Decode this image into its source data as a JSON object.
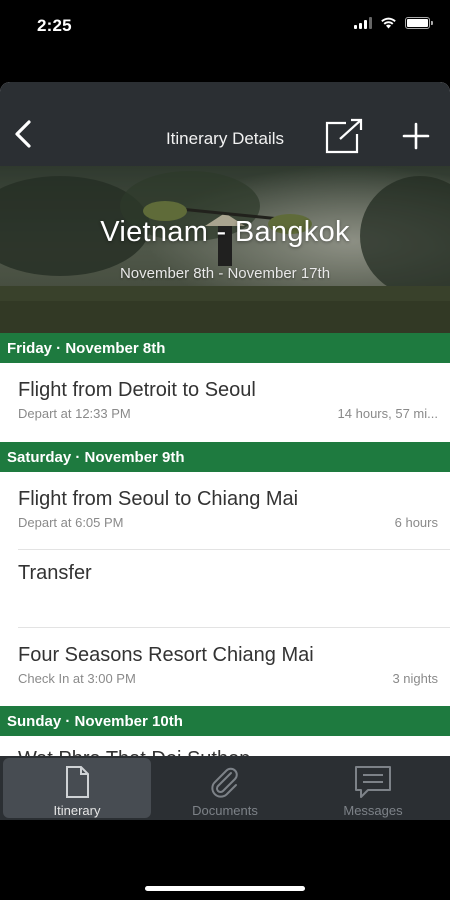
{
  "status_bar": {
    "time": "2:25"
  },
  "nav": {
    "title": "Itinerary Details",
    "back_icon": "chevron-left-icon",
    "share_icon": "share-external-icon",
    "add_icon": "plus-icon"
  },
  "hero": {
    "title": "Vietnam - Bangkok",
    "dates": "November 8th - November 17th"
  },
  "days": [
    {
      "header": "Friday · November 8th",
      "items": [
        {
          "title": "Flight from Detroit to Seoul",
          "subtitle": "Depart at 12:33 PM",
          "meta": "14 hours, 57 mi..."
        }
      ]
    },
    {
      "header": "Saturday · November 9th",
      "items": [
        {
          "title": "Flight from Seoul to Chiang Mai",
          "subtitle": "Depart at 6:05 PM",
          "meta": "6 hours"
        },
        {
          "title": "Transfer",
          "subtitle": "",
          "meta": ""
        },
        {
          "title": "Four Seasons Resort Chiang Mai",
          "subtitle": "Check In at 3:00 PM",
          "meta": "3 nights"
        }
      ]
    },
    {
      "header": "Sunday · November 10th",
      "items": [
        {
          "title": "Wat Phra That Doi Suthep",
          "subtitle": "",
          "meta": ""
        }
      ]
    }
  ],
  "tabs": [
    {
      "label": "Itinerary",
      "icon": "document-icon",
      "active": true
    },
    {
      "label": "Documents",
      "icon": "paperclip-icon",
      "active": false
    },
    {
      "label": "Messages",
      "icon": "chat-bubble-icon",
      "active": false
    }
  ],
  "colors": {
    "day_header": "#1e7a3f",
    "nav_background": "#2b2f33",
    "tab_active": "#474c52"
  }
}
